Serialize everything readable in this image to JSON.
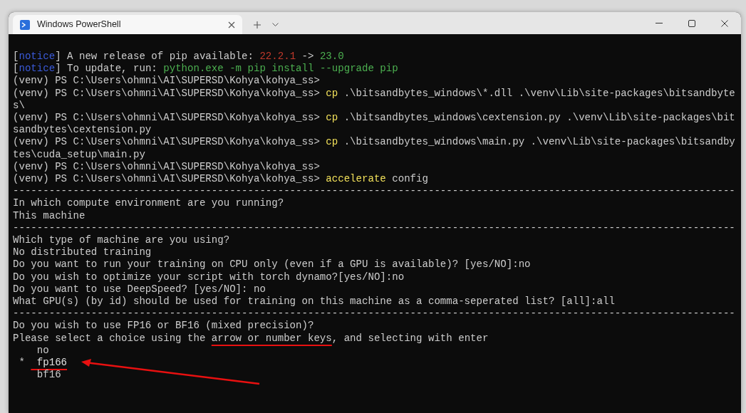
{
  "window": {
    "title": "Windows PowerShell"
  },
  "terminal": {
    "lines": [
      {
        "spans": [
          {
            "text": "["
          },
          {
            "text": "notice",
            "color": "#3b5bdb"
          },
          {
            "text": "] A new release of pip available: "
          },
          {
            "text": "22.2.1",
            "color": "#c0392b"
          },
          {
            "text": " -> "
          },
          {
            "text": "23.0",
            "color": "#4caf50"
          }
        ]
      },
      {
        "spans": [
          {
            "text": "["
          },
          {
            "text": "notice",
            "color": "#3b5bdb"
          },
          {
            "text": "] To update, run: "
          },
          {
            "text": "python.exe -m pip install --upgrade pip",
            "color": "#4caf50"
          }
        ]
      },
      {
        "spans": [
          {
            "text": "(venv) PS C:\\Users\\ohmni\\AI\\SUPERSD\\Kohya\\kohya_ss>"
          }
        ]
      },
      {
        "spans": [
          {
            "text": "(venv) PS C:\\Users\\ohmni\\AI\\SUPERSD\\Kohya\\kohya_ss> "
          },
          {
            "text": "cp",
            "color": "#f1e05a"
          },
          {
            "text": " .\\bitsandbytes_windows\\*.dll .\\venv\\Lib\\site-packages\\bitsandbyte"
          }
        ]
      },
      {
        "spans": [
          {
            "text": "s\\"
          }
        ]
      },
      {
        "spans": [
          {
            "text": "(venv) PS C:\\Users\\ohmni\\AI\\SUPERSD\\Kohya\\kohya_ss> "
          },
          {
            "text": "cp",
            "color": "#f1e05a"
          },
          {
            "text": " .\\bitsandbytes_windows\\cextension.py .\\venv\\Lib\\site-packages\\bit"
          }
        ]
      },
      {
        "spans": [
          {
            "text": "sandbytes\\cextension.py"
          }
        ]
      },
      {
        "spans": [
          {
            "text": "(venv) PS C:\\Users\\ohmni\\AI\\SUPERSD\\Kohya\\kohya_ss> "
          },
          {
            "text": "cp",
            "color": "#f1e05a"
          },
          {
            "text": " .\\bitsandbytes_windows\\main.py .\\venv\\Lib\\site-packages\\bitsandby"
          }
        ]
      },
      {
        "spans": [
          {
            "text": "tes\\cuda_setup\\main.py"
          }
        ]
      },
      {
        "spans": [
          {
            "text": "(venv) PS C:\\Users\\ohmni\\AI\\SUPERSD\\Kohya\\kohya_ss>"
          }
        ]
      },
      {
        "spans": [
          {
            "text": "(venv) PS C:\\Users\\ohmni\\AI\\SUPERSD\\Kohya\\kohya_ss> "
          },
          {
            "text": "accelerate",
            "color": "#f1e05a"
          },
          {
            "text": " config"
          }
        ]
      },
      {
        "spans": [
          {
            "text": "------------------------------------------------------------------------------------------------------------------------"
          }
        ]
      },
      {
        "spans": [
          {
            "text": "In which compute environment are you running?"
          }
        ]
      },
      {
        "spans": [
          {
            "text": "This machine"
          }
        ]
      },
      {
        "spans": [
          {
            "text": "------------------------------------------------------------------------------------------------------------------------"
          }
        ]
      },
      {
        "spans": [
          {
            "text": "Which type of machine are you using?"
          }
        ]
      },
      {
        "spans": [
          {
            "text": "No distributed training"
          }
        ]
      },
      {
        "spans": [
          {
            "text": "Do you want to run your training on CPU only (even if a GPU is available)? [yes/NO]:no"
          }
        ]
      },
      {
        "spans": [
          {
            "text": "Do you wish to optimize your script with torch dynamo?[yes/NO]:no"
          }
        ]
      },
      {
        "spans": [
          {
            "text": "Do you want to use DeepSpeed? [yes/NO]: no"
          }
        ]
      },
      {
        "spans": [
          {
            "text": "What GPU(s) (by id) should be used for training on this machine as a comma-seperated list? [all]:all"
          }
        ]
      },
      {
        "spans": [
          {
            "text": "------------------------------------------------------------------------------------------------------------------------"
          }
        ]
      },
      {
        "spans": [
          {
            "text": "Do you wish to use FP16 or BF16 (mixed precision)?"
          }
        ]
      },
      {
        "spans": [
          {
            "text": "Please select a choice using the "
          },
          {
            "text": "arrow or number keys",
            "underlined": true
          },
          {
            "text": ", and selecting with enter"
          }
        ]
      }
    ],
    "cursor": "*",
    "options": [
      {
        "label": "no",
        "selected": false
      },
      {
        "label": "fp166",
        "selected": true
      },
      {
        "label": "bf16",
        "selected": false
      }
    ]
  }
}
